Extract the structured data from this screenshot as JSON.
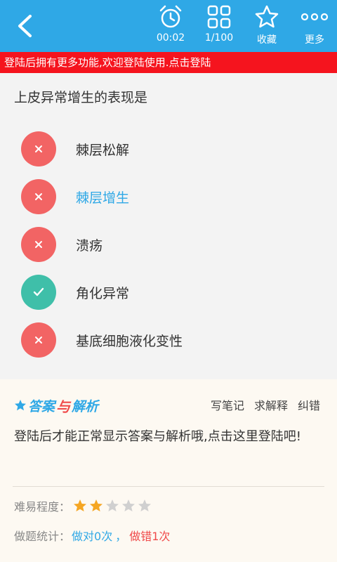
{
  "toolbar": {
    "timer": "00:02",
    "progress": "1/100",
    "favorite": "收藏",
    "more": "更多"
  },
  "banner": {
    "text": "登陆后拥有更多功能,欢迎登陆使用.点击登陆"
  },
  "question": {
    "text": "上皮异常增生的表现是",
    "options": [
      {
        "label": "棘层松解",
        "mark": "wrong"
      },
      {
        "label": "棘层增生",
        "mark": "wrong",
        "selected": true
      },
      {
        "label": "溃疡",
        "mark": "wrong"
      },
      {
        "label": "角化异常",
        "mark": "right"
      },
      {
        "label": "基底细胞液化变性",
        "mark": "wrong"
      }
    ]
  },
  "answer": {
    "title_part1": "答案",
    "title_part2": "与",
    "title_part3": "解析",
    "actions": [
      "写笔记",
      "求解释",
      "纠错"
    ],
    "text": "登陆后才能正常显示答案与解析哦,点击这里登陆吧!",
    "difficulty_label": "难易程度：",
    "difficulty_stars": 2,
    "difficulty_max": 5,
    "stats_label": "做题统计：",
    "stats_right": "做对0次",
    "stats_sep": "，",
    "stats_wrong": "做错1次"
  },
  "colors": {
    "primary": "#2fa8e6",
    "banner": "#f5141e",
    "wrong": "#f26464",
    "right": "#3fbfa9",
    "star_on": "#f5a623",
    "star_off": "#d0d0d0"
  }
}
